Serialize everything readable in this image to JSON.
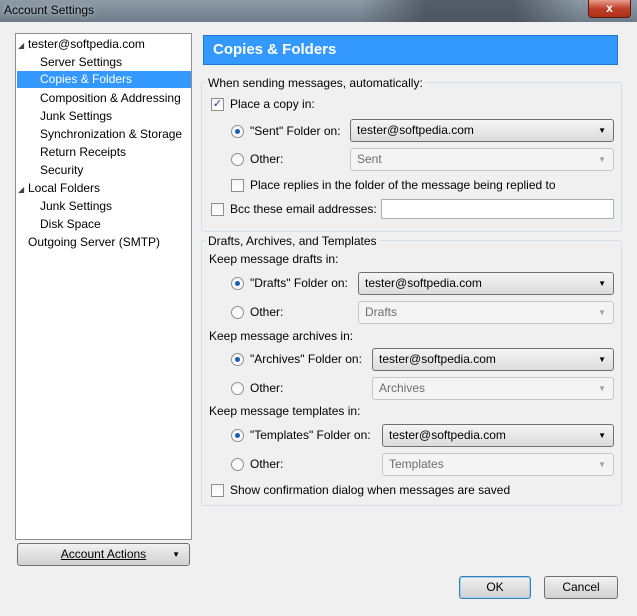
{
  "window": {
    "title": "Account Settings",
    "close_glyph": "x"
  },
  "tree": [
    {
      "label": "tester@softpedia.com",
      "toggle": "◢",
      "selected": false
    },
    {
      "label": "Server Settings",
      "selected": false
    },
    {
      "label": "Copies & Folders",
      "selected": true
    },
    {
      "label": "Composition & Addressing",
      "selected": false
    },
    {
      "label": "Junk Settings",
      "selected": false
    },
    {
      "label": "Synchronization & Storage",
      "selected": false
    },
    {
      "label": "Return Receipts",
      "selected": false
    },
    {
      "label": "Security",
      "selected": false
    },
    {
      "label": "Local Folders",
      "toggle": "◢",
      "selected": false
    },
    {
      "label": "Junk Settings",
      "selected": false
    },
    {
      "label": "Disk Space",
      "selected": false
    },
    {
      "label": "Outgoing Server (SMTP)",
      "selected": false
    }
  ],
  "account_actions": {
    "label": "Account Actions",
    "arrow": "▼"
  },
  "panel": {
    "title": "Copies & Folders",
    "sending": {
      "group_label": "When sending messages, automatically:",
      "place_copy": {
        "label": "Place a copy in:",
        "checked": true
      },
      "sent_folder": {
        "label": "\"Sent\" Folder on:",
        "value": "tester@softpedia.com",
        "selected": true
      },
      "other": {
        "label": "Other:",
        "value": "Sent",
        "selected": false
      },
      "place_replies": {
        "label": "Place replies in the folder of the message being replied to",
        "checked": false
      },
      "bcc": {
        "label": "Bcc these email addresses:",
        "checked": false,
        "value": ""
      }
    },
    "drafts": {
      "group_label": "Drafts, Archives, and Templates",
      "drafts_heading": "Keep message drafts in:",
      "drafts_folder": {
        "label": "\"Drafts\" Folder on:",
        "value": "tester@softpedia.com",
        "selected": true
      },
      "drafts_other": {
        "label": "Other:",
        "value": "Drafts",
        "selected": false
      },
      "archives_heading": "Keep message archives in:",
      "archives_folder": {
        "label": "\"Archives\" Folder on:",
        "value": "tester@softpedia.com",
        "selected": true
      },
      "archives_other": {
        "label": "Other:",
        "value": "Archives",
        "selected": false
      },
      "templates_heading": "Keep message templates in:",
      "templates_folder": {
        "label": "\"Templates\" Folder on:",
        "value": "tester@softpedia.com",
        "selected": true
      },
      "templates_other": {
        "label": "Other:",
        "value": "Templates",
        "selected": false
      },
      "confirm": {
        "label": "Show confirmation dialog when messages are saved",
        "checked": false
      }
    }
  },
  "buttons": {
    "ok": "OK",
    "cancel": "Cancel"
  },
  "colors": {
    "accent": "#3399ff",
    "title_bar": "#7f8b97",
    "close": "#c0402a"
  }
}
